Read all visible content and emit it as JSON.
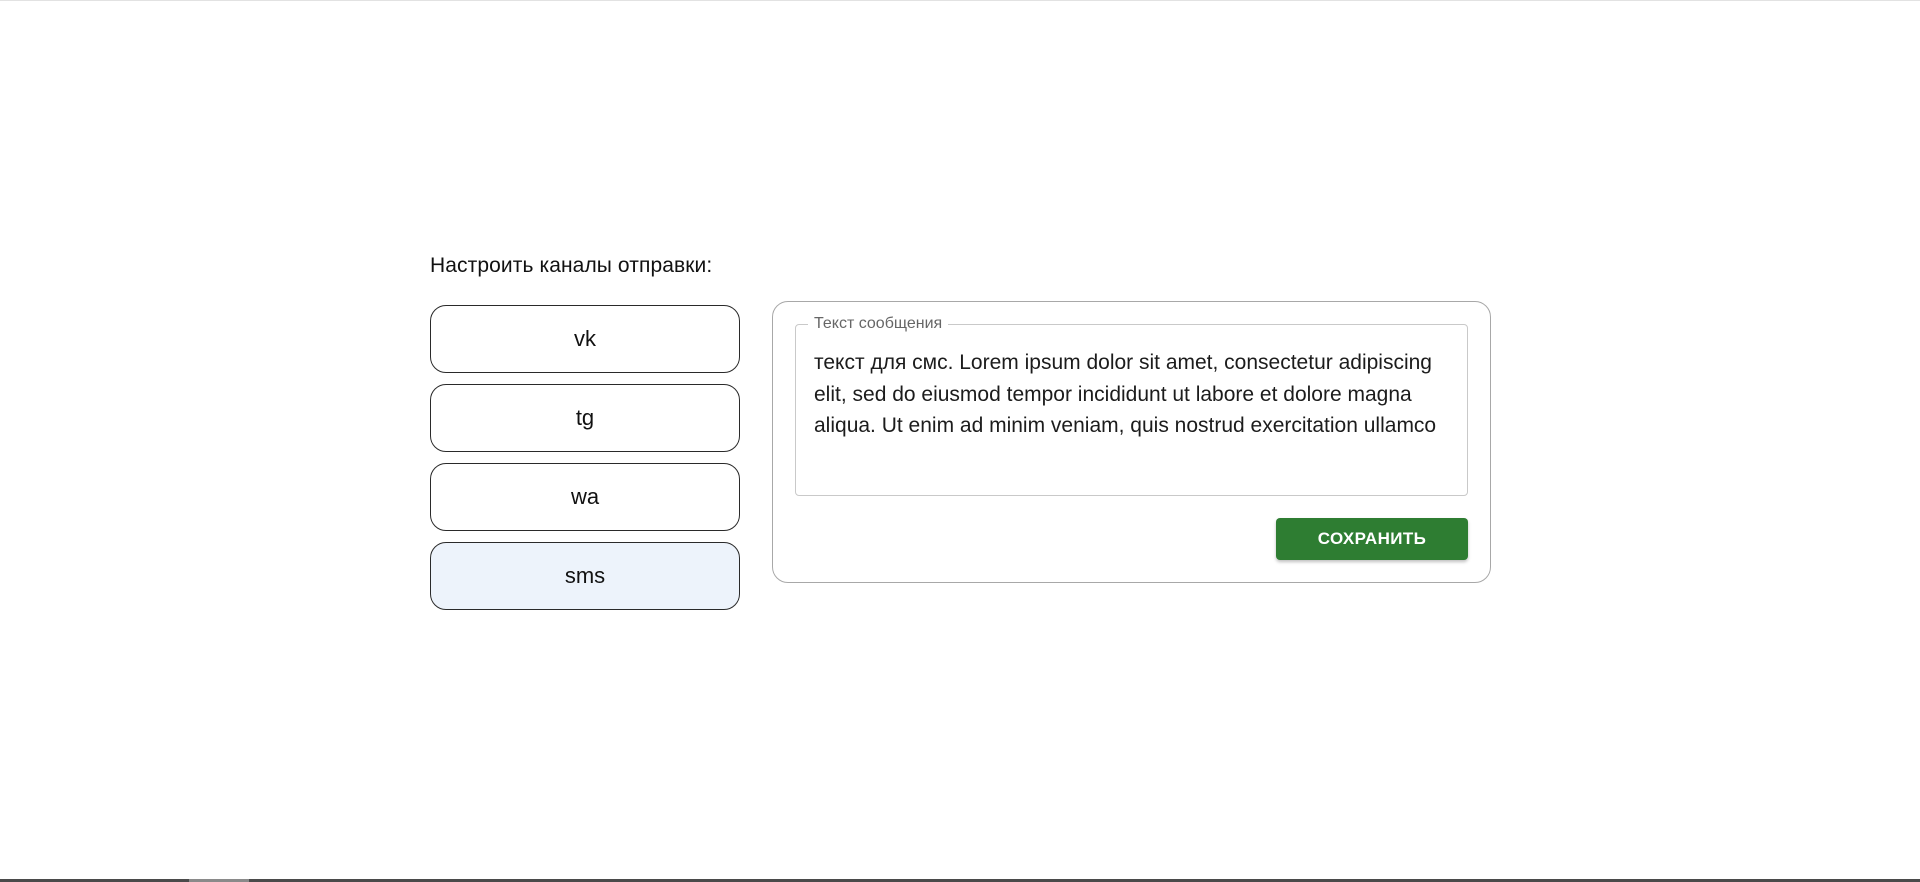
{
  "page": {
    "section_title": "Настроить каналы отправки:"
  },
  "channels": {
    "items": [
      {
        "label": "vk",
        "selected": false
      },
      {
        "label": "tg",
        "selected": false
      },
      {
        "label": "wa",
        "selected": false
      },
      {
        "label": "sms",
        "selected": true
      }
    ]
  },
  "message": {
    "field_label": "Текст сообщения",
    "value": "текст для смс. Lorem ipsum dolor sit amet, consectetur adipiscing elit, sed do eiusmod tempor incididunt ut labore et dolore magna aliqua. Ut enim ad minim veniam, quis nostrud exercitation ullamco",
    "save_label": "СОХРАНИТЬ"
  },
  "colors": {
    "accent_green": "#2e7d32",
    "selected_channel_bg": "#edf3fb"
  }
}
